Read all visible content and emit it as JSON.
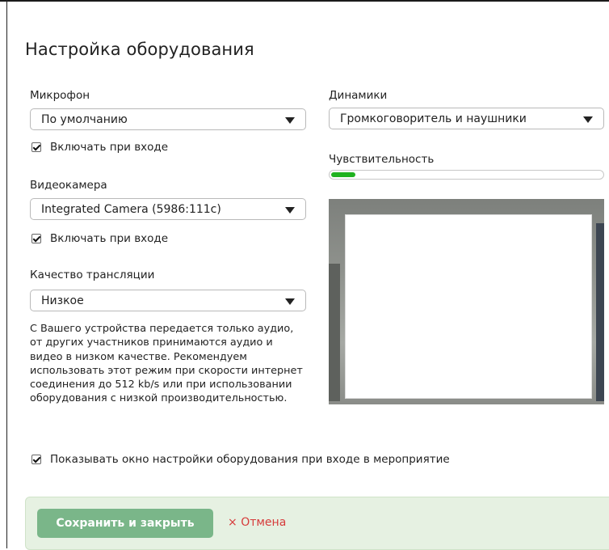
{
  "dialog": {
    "title": "Настройка оборудования",
    "microphone": {
      "label": "Микрофон",
      "selected": "По умолчанию",
      "enable_on_join_label": "Включать при входе",
      "enable_on_join_checked": true
    },
    "camera": {
      "label": "Видеокамера",
      "selected": "Integrated Camera (5986:111c)",
      "enable_on_join_label": "Включать при входе",
      "enable_on_join_checked": true
    },
    "quality": {
      "label": "Качество трансляции",
      "selected": "Низкое",
      "description": "С Вашего устройства передается только аудио, от других участников принимаются аудио и видео в низком качестве. Рекомендуем использовать этот режим при скорости интернет соединения до 512 kb/s или при использовании оборудования с низкой производительностью."
    },
    "speakers": {
      "label": "Динамики",
      "selected": "Громкоговоритель и наушники"
    },
    "sensitivity": {
      "label": "Чувствительность",
      "level": 0.09,
      "color": "#1fb21f"
    },
    "show_on_join": {
      "label": "Показывать окно настройки оборудования при входе в мероприятие",
      "checked": true
    },
    "footer": {
      "save_label": "Сохранить и закрыть",
      "cancel_label": "Отмена",
      "cancel_icon": "×"
    }
  }
}
